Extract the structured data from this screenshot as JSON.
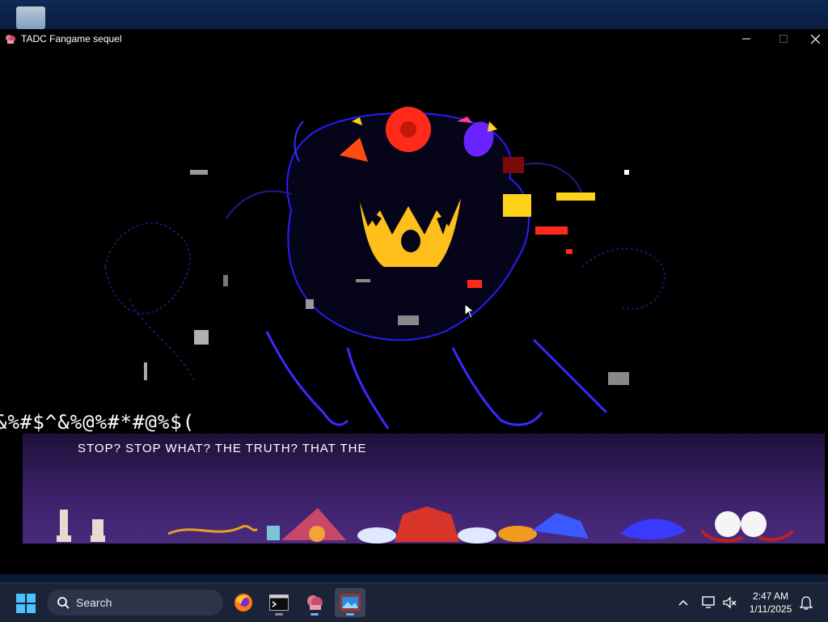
{
  "window": {
    "title": "TADC Fangame sequel"
  },
  "game": {
    "glitch_text": "&%#$^&%@%#*#@%$(",
    "dialogue": "STOP? STOP WHAT? THE TRUTH? THAT THE"
  },
  "taskbar": {
    "search_label": "Search",
    "time": "2:47 AM",
    "date": "1/11/2025",
    "apps": [
      {
        "name": "firefox",
        "icon": "firefox-icon"
      },
      {
        "name": "terminal",
        "icon": "terminal-icon"
      },
      {
        "name": "tadc-game",
        "icon": "game-icon"
      },
      {
        "name": "photos",
        "icon": "photos-icon"
      }
    ]
  },
  "colors": {
    "taskbar_bg": "#1b2436",
    "dialogue_bg_top": "#1e1138",
    "dialogue_bg_bottom": "#4a2a7c",
    "glitch_red": "#ff2a1a",
    "glitch_yellow": "#ffd21a",
    "glitch_blue": "#2a1cff"
  }
}
